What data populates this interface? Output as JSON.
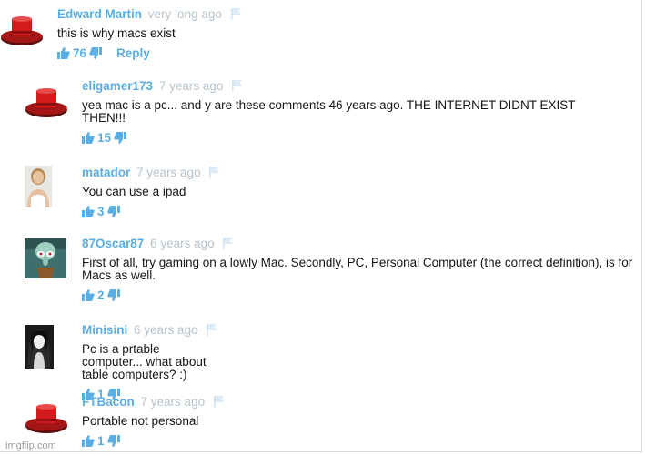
{
  "comments": [
    {
      "username": "Edward Martin",
      "time": "very long ago",
      "text": "this is why macs exist",
      "likes": "76",
      "reply": "Reply",
      "avatar": "red-hat-icon"
    },
    {
      "username": "eligamer173",
      "time": "7 years ago",
      "text": "yea mac is a pc... and y are these comments 46 years ago. THE INTERNET DIDNT EXIST THEN!!!",
      "likes": "15",
      "avatar": "red-hat-icon"
    },
    {
      "username": "matador",
      "time": "7 years ago",
      "text": "You can use a ipad",
      "likes": "3",
      "avatar": "profile-photo-woman"
    },
    {
      "username": "87Oscar87",
      "time": "6 years ago",
      "text": "First of all, try gaming on a lowly Mac. Secondly, PC, Personal Computer (the correct definition), is for Macs as well.",
      "likes": "2",
      "avatar": "squidward-avatar"
    },
    {
      "username": "Minisini",
      "time": "6 years ago",
      "text": "Pc is a prtable computer... what about table computers? :)",
      "likes": "1",
      "avatar": "dark-hair-avatar"
    },
    {
      "username": "FTBacon",
      "time": "7 years ago",
      "text": "Portable not personal",
      "likes": "1",
      "avatar": "red-hat-icon"
    }
  ],
  "watermark": "imgflip.com",
  "colors": {
    "username": "#5aaee3",
    "timestamp": "#b7c4cd",
    "text": "#151515"
  }
}
